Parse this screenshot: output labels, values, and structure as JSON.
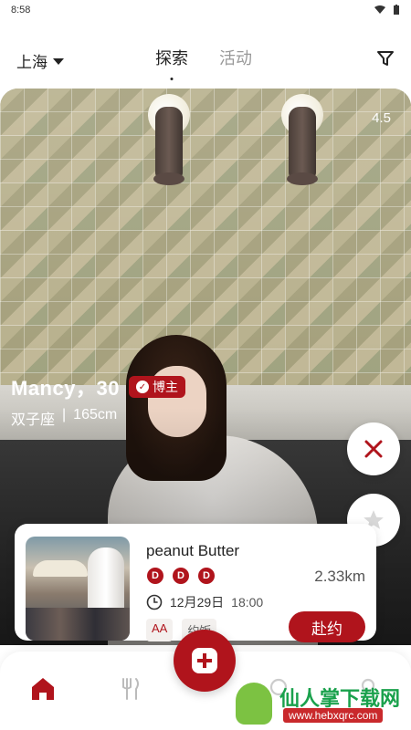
{
  "status_bar": {
    "time": "8:58"
  },
  "top_nav": {
    "city": "上海",
    "tabs": [
      {
        "label": "探索",
        "active": true
      },
      {
        "label": "活动",
        "active": false
      }
    ]
  },
  "profile": {
    "rating": "4.5",
    "name_age": "Mancy，30",
    "badge": "博主",
    "zodiac": "双子座",
    "divider": "|",
    "height": "165cm"
  },
  "event": {
    "title": "peanut Butter",
    "d_icons": [
      "D",
      "D",
      "D"
    ],
    "distance": "2.33km",
    "date": "12月29日",
    "time": "18:00",
    "tags": [
      "AA",
      "约饭"
    ],
    "join_label": "赴约"
  },
  "bottom_nav": {
    "items": [
      "home-icon",
      "restaurant-icon",
      "add-icon",
      "search-icon",
      "profile-icon"
    ]
  },
  "watermark": {
    "text": "仙人掌下载网",
    "url": "www.hebxqrc.com"
  },
  "colors": {
    "accent": "#b0141c"
  }
}
